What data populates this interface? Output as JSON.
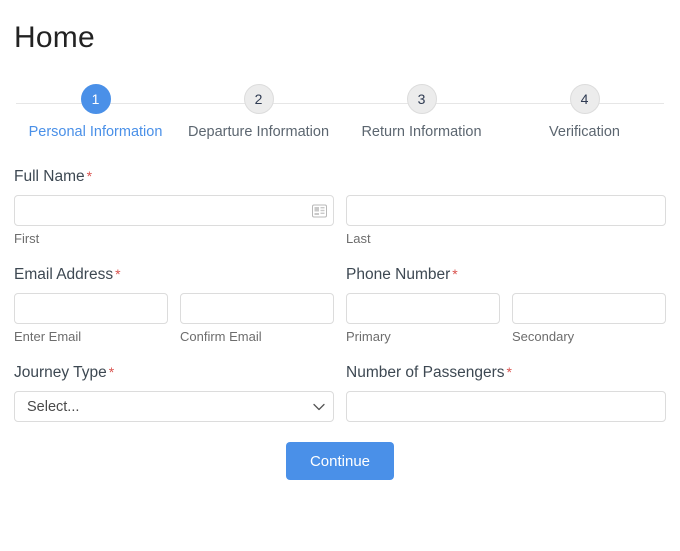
{
  "header": {
    "title": "Home"
  },
  "stepper": {
    "steps": [
      {
        "number": "1",
        "label": "Personal Information",
        "active": true
      },
      {
        "number": "2",
        "label": "Departure Information",
        "active": false
      },
      {
        "number": "3",
        "label": "Return Information",
        "active": false
      },
      {
        "number": "4",
        "label": "Verification",
        "active": false
      }
    ],
    "active_color": "#4a90e8",
    "inactive_color": "#5c6670"
  },
  "form": {
    "required_marker": "*",
    "full_name": {
      "label": "Full Name",
      "icon": "contact-card-icon",
      "first": {
        "value": "",
        "placeholder": "",
        "sub_label": "First"
      },
      "last": {
        "value": "",
        "placeholder": "",
        "sub_label": "Last"
      }
    },
    "email": {
      "label": "Email Address",
      "enter": {
        "value": "",
        "placeholder": "",
        "sub_label": "Enter Email"
      },
      "confirm": {
        "value": "",
        "placeholder": "",
        "sub_label": "Confirm Email"
      }
    },
    "phone": {
      "label": "Phone Number",
      "primary": {
        "value": "",
        "placeholder": "",
        "sub_label": "Primary"
      },
      "secondary": {
        "value": "",
        "placeholder": "",
        "sub_label": "Secondary"
      }
    },
    "journey_type": {
      "label": "Journey Type",
      "selected": "Select...",
      "chevron": "chevron-down-icon"
    },
    "passengers": {
      "label": "Number of Passengers",
      "value": "",
      "placeholder": ""
    }
  },
  "footer": {
    "continue_label": "Continue",
    "button_color": "#4a90e8"
  }
}
